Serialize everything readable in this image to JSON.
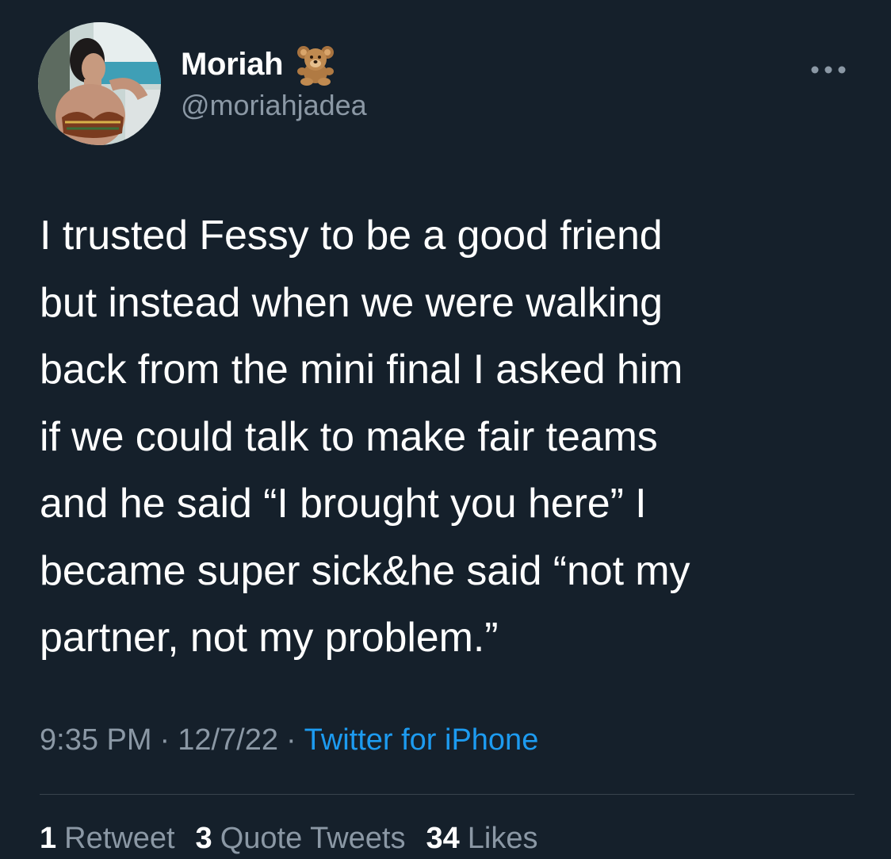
{
  "author": {
    "display_name": "Moriah",
    "handle": "@moriahjadea",
    "name_emoji": "teddy-bear-icon"
  },
  "tweet": {
    "text": "I trusted Fessy to be a good friend\nbut instead when we were walking\nback from the mini final I asked him\nif we could talk to make fair teams\nand he said “I brought you here” I\nbecame super sick&he said “not my\npartner, not my problem.”"
  },
  "meta": {
    "time": "9:35 PM",
    "separator": "·",
    "date": "12/7/22",
    "source": "Twitter for iPhone"
  },
  "stats": {
    "retweets_count": "1",
    "retweets_label": "Retweet",
    "quotes_count": "3",
    "quotes_label": "Quote Tweets",
    "likes_count": "34",
    "likes_label": "Likes"
  },
  "colors": {
    "background": "#15202b",
    "text": "#ffffff",
    "secondary": "#8b98a5",
    "link": "#1d9bf0",
    "divider": "#38444d"
  }
}
